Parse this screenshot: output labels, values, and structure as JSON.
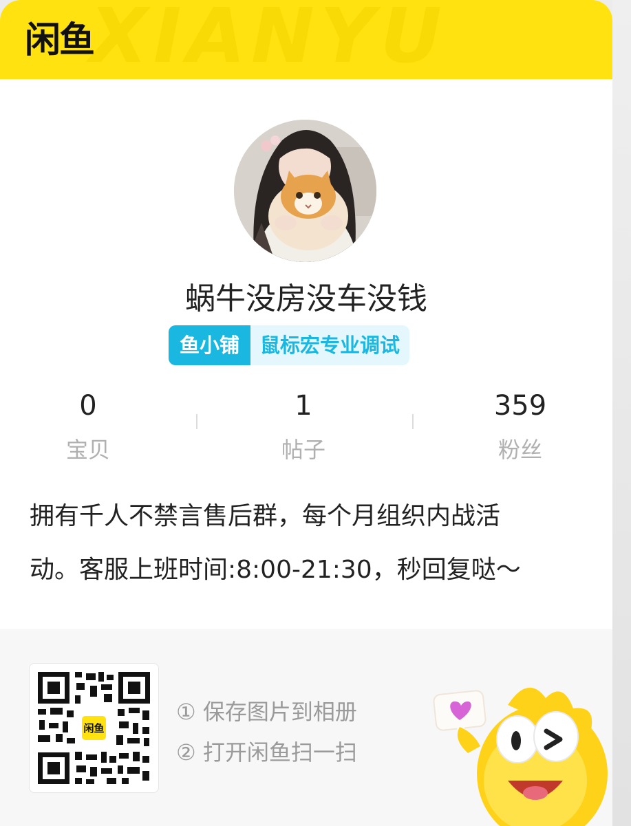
{
  "header": {
    "logo_text": "闲鱼",
    "watermark_text": "XIANYU",
    "background_color": "#ffe20f"
  },
  "profile": {
    "avatar": "user-avatar-photo",
    "name": "蜗牛没房没车没钱"
  },
  "shop_badge": {
    "label": "鱼小铺",
    "description": "鼠标宏专业调试",
    "accent_color": "#1ab8e0"
  },
  "stats": [
    {
      "value": "0",
      "label": "宝贝"
    },
    {
      "value": "1",
      "label": "帖子"
    },
    {
      "value": "359",
      "label": "粉丝"
    }
  ],
  "bio_lines": [
    "拥有千人不禁言售后群，每个月组织内战活",
    "动。客服上班时间:8:00-21:30，秒回复哒～"
  ],
  "qr": {
    "center_text": "闲鱼",
    "icon": "qr-code"
  },
  "instructions": [
    "① 保存图片到相册",
    "② 打开闲鱼扫一扫"
  ],
  "mascot": {
    "icon": "fish-mascot",
    "bubble_icon": "heart-icon"
  }
}
